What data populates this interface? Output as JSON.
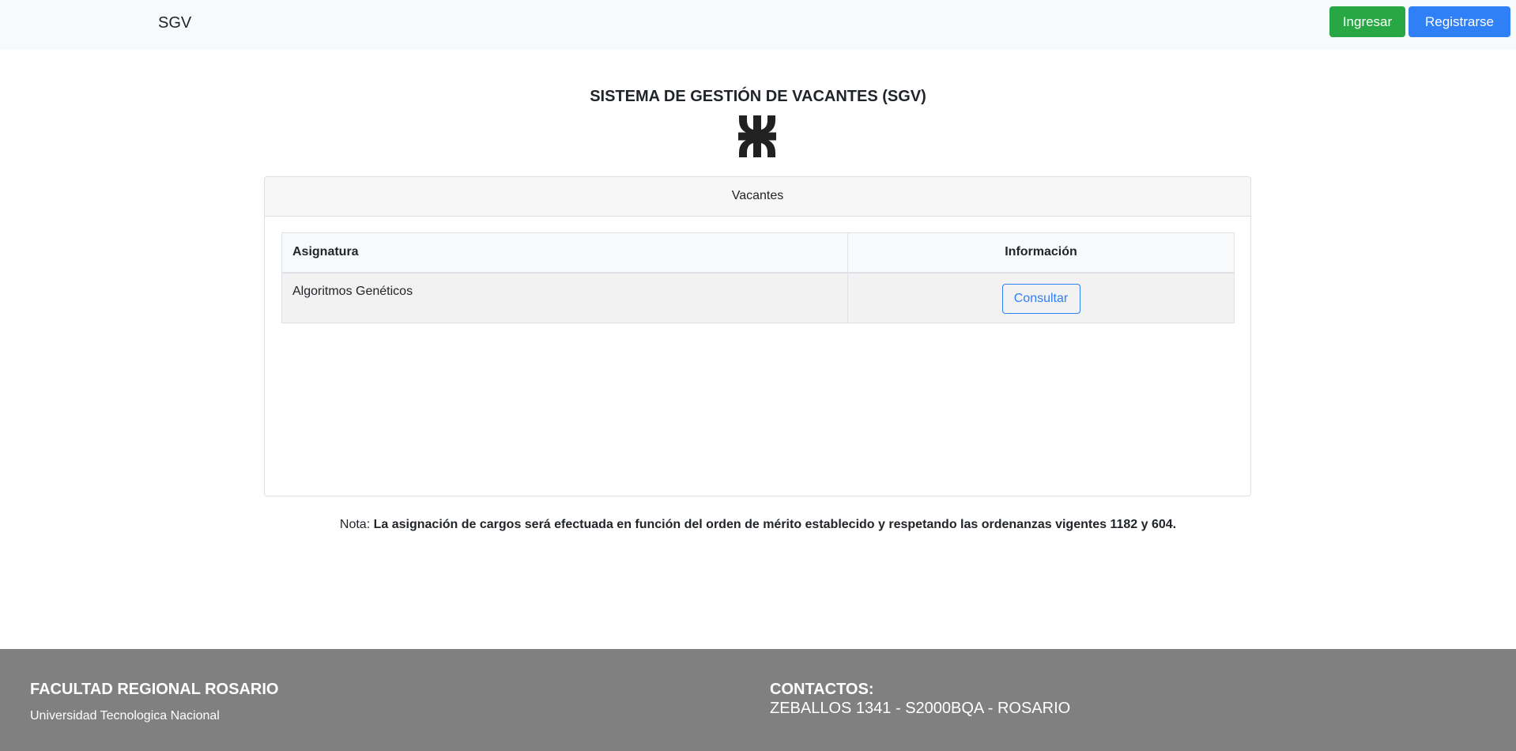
{
  "navbar": {
    "brand": "SGV",
    "login_label": "Ingresar",
    "register_label": "Registrarse"
  },
  "page": {
    "title": "SISTEMA DE GESTIÓN DE VACANTES (SGV)",
    "logo_icon": "utn-logo-icon"
  },
  "card": {
    "header": "Vacantes",
    "table": {
      "columns": [
        "Asignatura",
        "Información"
      ],
      "rows": [
        {
          "asignatura": "Algoritmos Genéticos",
          "action_label": "Consultar"
        }
      ]
    }
  },
  "note": {
    "prefix": "Nota:",
    "text": "La asignación de cargos será efectuada en función del orden de mérito establecido y respetando las ordenanzas vigentes 1182 y 604."
  },
  "footer": {
    "title": "FACULTAD REGIONAL ROSARIO",
    "subtitle": "Universidad Tecnologica Nacional",
    "contact_title": "CONTACTOS:",
    "contact_address": "ZEBALLOS 1341 - S2000BQA - ROSARIO"
  },
  "colors": {
    "navbar_bg": "#f8f9fa",
    "login_green": "#28a745",
    "primary_blue": "#2f7ff7",
    "footer_gray": "#808080"
  }
}
